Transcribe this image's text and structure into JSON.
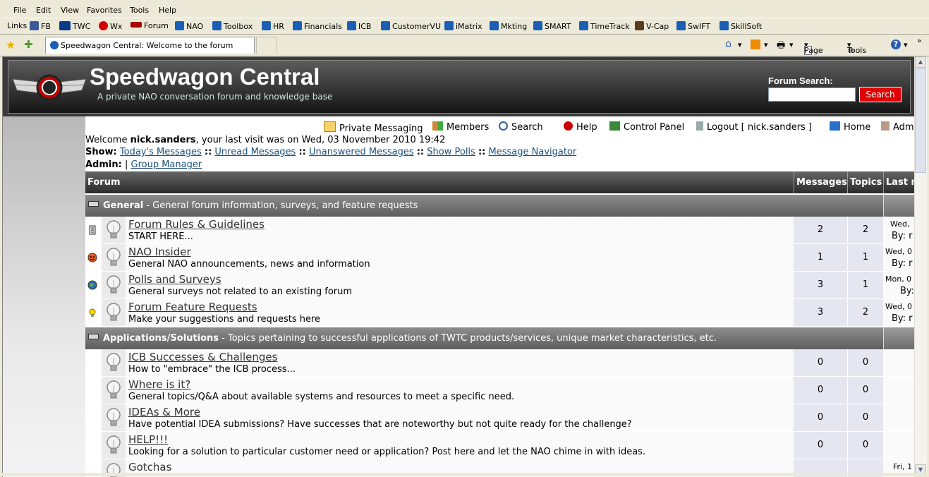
{
  "browser": {
    "menu": [
      "File",
      "Edit",
      "View",
      "Favorites",
      "Tools",
      "Help"
    ],
    "links_label": "Links",
    "links": [
      {
        "label": "FB",
        "icon": "facebook-icon",
        "color": "#3b5998"
      },
      {
        "label": "TWC",
        "icon": "twc-icon",
        "color": "#0a3a8a"
      },
      {
        "label": "Wx",
        "icon": "weather-icon",
        "color": "#d40000"
      },
      {
        "label": "Forum",
        "icon": "speedwagon-icon",
        "color": "#a00"
      },
      {
        "label": "NAO",
        "icon": "ie-icon",
        "color": "#1a5fb4"
      },
      {
        "label": "Toolbox",
        "icon": "ie-icon",
        "color": "#1a5fb4"
      },
      {
        "label": "HR",
        "icon": "ie-icon",
        "color": "#1a5fb4"
      },
      {
        "label": "Financials",
        "icon": "ie-icon",
        "color": "#1a5fb4"
      },
      {
        "label": "ICB",
        "icon": "ie-icon",
        "color": "#1a5fb4"
      },
      {
        "label": "CustomerVU",
        "icon": "ie-icon",
        "color": "#1a5fb4"
      },
      {
        "label": "iMatrix",
        "icon": "ie-icon",
        "color": "#1a5fb4"
      },
      {
        "label": "Mkting",
        "icon": "ie-icon",
        "color": "#1a5fb4"
      },
      {
        "label": "SMART",
        "icon": "ie-icon",
        "color": "#1a5fb4"
      },
      {
        "label": "TimeTrack",
        "icon": "ie-icon",
        "color": "#1a5fb4"
      },
      {
        "label": "V-Cap",
        "icon": "vcap-icon",
        "color": "#5a3c1a"
      },
      {
        "label": "SwIFT",
        "icon": "ie-icon",
        "color": "#1a5fb4"
      },
      {
        "label": "SkillSoft",
        "icon": "ie-icon",
        "color": "#1a5fb4"
      }
    ],
    "tab_title": "Speedwagon Central: Welcome to the forum",
    "cmd": {
      "page": "Page",
      "tools": "Tools"
    }
  },
  "site": {
    "title": "Speedwagon Central",
    "subtitle": "A private NAO conversation forum and knowledge base",
    "search_label": "Forum Search:",
    "search_value": "",
    "search_button": "Search"
  },
  "nav": [
    {
      "label": "Private Messaging",
      "icon": "envelope-icon"
    },
    {
      "label": "Members",
      "icon": "members-icon"
    },
    {
      "label": "Search",
      "icon": "magnifier-icon"
    },
    {
      "label": "Help",
      "icon": "help-icon"
    },
    {
      "label": "Control Panel",
      "icon": "control-panel-icon"
    },
    {
      "label": "Logout [ nick.sanders ]",
      "icon": "logout-icon"
    },
    {
      "label": "Home",
      "icon": "home-icon"
    },
    {
      "label": "Adm",
      "icon": "admin-icon"
    }
  ],
  "welcome": {
    "prefix": "Welcome ",
    "user": "nick.sanders",
    "rest": ", your last visit was on Wed, 03 November 2010 19:42"
  },
  "show": {
    "label": "Show:",
    "links": [
      "Today's Messages",
      "Unread Messages",
      "Unanswered Messages",
      "Show Polls",
      "Message Navigator"
    ],
    "sep": "::"
  },
  "admin": {
    "label": "Admin:",
    "sep": "|",
    "link": "Group Manager"
  },
  "table": {
    "headers": {
      "forum": "Forum",
      "messages": "Messages",
      "topics": "Topics",
      "last": "Last m"
    },
    "categories": [
      {
        "name": "General",
        "desc": " - General forum information, surveys, and feature requests",
        "forums": [
          {
            "name": "Forum Rules & Guidelines",
            "desc": "START HERE...",
            "messages": "2",
            "topics": "2",
            "last1": "Wed,",
            "last2": "By: r",
            "icon": "document-icon"
          },
          {
            "name": "NAO Insider",
            "desc": "General NAO announcements, news and information",
            "messages": "1",
            "topics": "1",
            "last1": "Wed, 0",
            "last2": "By: r",
            "icon": "smiley-icon"
          },
          {
            "name": "Polls and Surveys",
            "desc": "General surveys not related to an existing forum",
            "messages": "3",
            "topics": "1",
            "last1": "Mon, 0",
            "last2": "By:",
            "icon": "globe-icon"
          },
          {
            "name": "Forum Feature Requests",
            "desc": "Make your suggestions and requests here",
            "messages": "3",
            "topics": "2",
            "last1": "Wed, 0",
            "last2": "By: r",
            "icon": "lightbulb-icon"
          }
        ]
      },
      {
        "name": "Applications/Solutions",
        "desc": " - Topics pertaining to successful applications of TWTC products/services, unique market characteristics, etc.",
        "forums": [
          {
            "name": "ICB Successes & Challenges",
            "desc": "How to \"embrace\" the ICB process...",
            "messages": "0",
            "topics": "0",
            "last1": "",
            "last2": "",
            "icon": ""
          },
          {
            "name": "Where is it?",
            "desc": "General topics/Q&A about available systems and resources to meet a specific need.",
            "messages": "0",
            "topics": "0",
            "last1": "",
            "last2": "",
            "icon": ""
          },
          {
            "name": "IDEAs & More",
            "desc": "Have potential IDEA submissions? Have successes that are noteworthy but not quite ready for the challenge?",
            "messages": "0",
            "topics": "0",
            "last1": "",
            "last2": "",
            "icon": ""
          },
          {
            "name": "HELP!!!",
            "desc": "Looking for a solution to particular customer need or application? Post here and let the NAO chime in with ideas.",
            "messages": "0",
            "topics": "0",
            "last1": "",
            "last2": "",
            "icon": ""
          },
          {
            "name": "Gotchas",
            "desc": "",
            "messages": "",
            "topics": "",
            "last1": "Fri, 1",
            "last2": "",
            "icon": ""
          }
        ]
      }
    ]
  }
}
